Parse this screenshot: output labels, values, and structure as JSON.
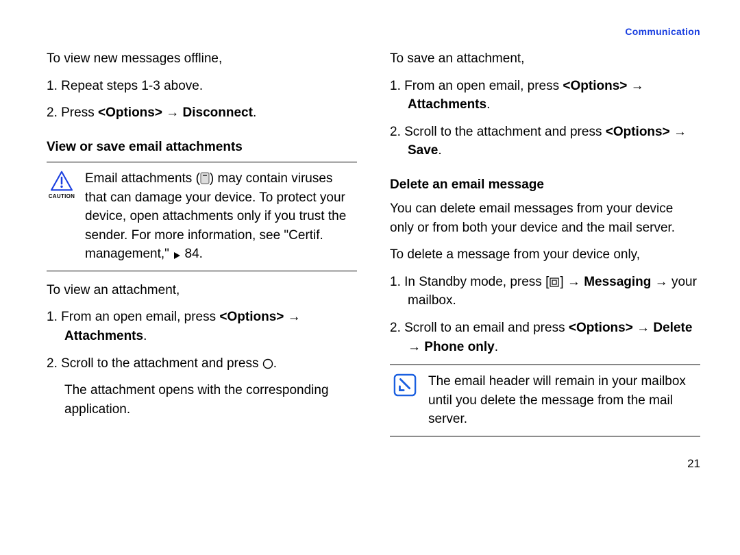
{
  "header": {
    "section": "Communication"
  },
  "page_number": "21",
  "left": {
    "intro": "To view new messages offline,",
    "step1": "1. Repeat steps 1-3 above.",
    "step2_pre": "2. Press ",
    "step2_opt": "<Options>",
    "step2_arrow": " → ",
    "step2_disc": "Disconnect",
    "step2_post": ".",
    "heading": "View or save email attachments",
    "caution_label": "CAUTION",
    "caution_a": "Email attachments (",
    "caution_b": ") may contain viruses that can damage your device. To protect your device, open attachments only if you trust the sender. For more information, see \"Certif. management,\" ",
    "caution_ref": " 84.",
    "view_intro": "To view an attachment,",
    "view1_pre": "1. From an open email, press ",
    "view1_opt": "<Options>",
    "view1_arrow": " → ",
    "view1_att": "Attachments",
    "view1_post": ".",
    "view2_pre": "2. Scroll to the attachment and press ",
    "view2_post": ".",
    "view_result": "The attachment opens with the corresponding application."
  },
  "right": {
    "save_intro": "To save an attachment,",
    "save1_pre": "1. From an open email, press ",
    "save1_opt": "<Options>",
    "save1_arrow": " → ",
    "save1_att": "Attachments",
    "save1_post": ".",
    "save2_pre": "2. Scroll to the attachment and press ",
    "save2_opt": "<Options>",
    "save2_arrow": " → ",
    "save2_save": "Save",
    "save2_post": ".",
    "heading": "Delete an email message",
    "del_intro": "You can delete email messages from your device only or from both your device and the mail server.",
    "del_cond": "To delete a message from your device only,",
    "del1_pre": "1. In Standby mode, press [",
    "del1_mid": "] → ",
    "del1_msg": "Messaging",
    "del1_arrow": " → ",
    "del1_post": "your mailbox.",
    "del2_pre": "2. Scroll to an email and press ",
    "del2_opt": "<Options>",
    "del2_arrow1": " → ",
    "del2_del": "Delete",
    "del2_arrow2": " → ",
    "del2_phone": "Phone only",
    "del2_post": ".",
    "note": "The email header will remain in your mailbox until you delete the message from the mail server."
  }
}
